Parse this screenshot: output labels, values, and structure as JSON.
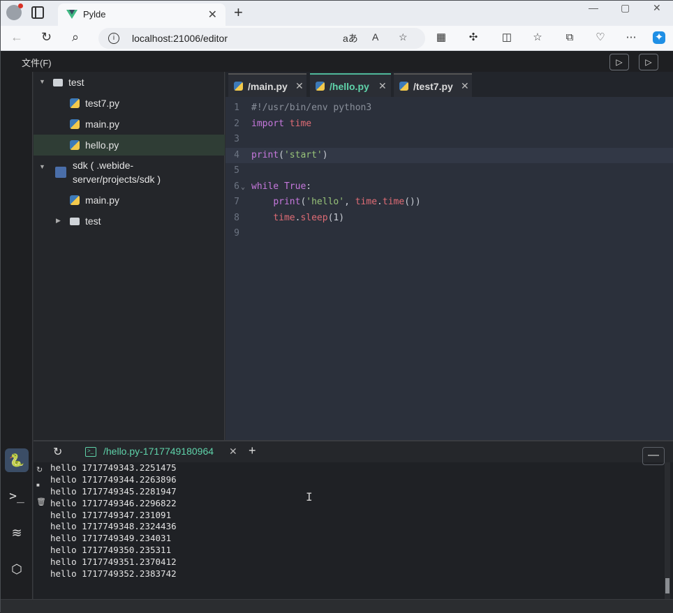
{
  "browser": {
    "tab_title": "Pylde",
    "url": "localhost:21006/editor",
    "close_symbol": "✕",
    "new_tab_symbol": "+",
    "window_controls": [
      "—",
      "▢",
      "✕"
    ]
  },
  "app": {
    "menu_file": "文件(F)"
  },
  "tree": {
    "items": [
      {
        "label": "test",
        "type": "folder",
        "expanded": true,
        "depth": 0
      },
      {
        "label": "test7.py",
        "type": "py",
        "depth": 1
      },
      {
        "label": "main.py",
        "type": "py",
        "depth": 1
      },
      {
        "label": "hello.py",
        "type": "py",
        "depth": 1,
        "selected": true
      },
      {
        "label_line1": "sdk ( .webide-",
        "label_line2": "server/projects/sdk )",
        "type": "sdk",
        "expanded": true,
        "depth": 0
      },
      {
        "label": "main.py",
        "type": "py",
        "depth": 1
      },
      {
        "label": "test",
        "type": "folder",
        "expanded": false,
        "depth": 1
      }
    ]
  },
  "editor": {
    "tabs": [
      {
        "label": "/main.py",
        "active": false
      },
      {
        "label": "/hello.py",
        "active": true
      },
      {
        "label": "/test7.py",
        "active": false
      }
    ],
    "lines": [
      {
        "n": "1",
        "text": "#!/usr/bin/env python3"
      },
      {
        "n": "2",
        "text": "import time"
      },
      {
        "n": "3",
        "text": ""
      },
      {
        "n": "4",
        "text": "print('start')"
      },
      {
        "n": "5",
        "text": ""
      },
      {
        "n": "6",
        "text": "while True:"
      },
      {
        "n": "7",
        "text": "    print('hello', time.time())"
      },
      {
        "n": "8",
        "text": "    time.sleep(1)"
      },
      {
        "n": "9",
        "text": ""
      }
    ]
  },
  "terminal": {
    "tab_label": "/hello.py-1717749180964",
    "minimize_symbol": "—",
    "output": [
      "hello 1717749343.2251475",
      "hello 1717749344.2263896",
      "hello 1717749345.2281947",
      "hello 1717749346.2296822",
      "hello 1717749347.231091",
      "hello 1717749348.2324436",
      "hello 1717749349.234031",
      "hello 1717749350.235311",
      "hello 1717749351.2370412",
      "hello 1717749352.2383742"
    ]
  },
  "colors": {
    "accent": "#5fd3aa",
    "keyword": "#c678dd",
    "builtin": "#e06c75",
    "string": "#98c379",
    "comment": "#8a909b"
  }
}
